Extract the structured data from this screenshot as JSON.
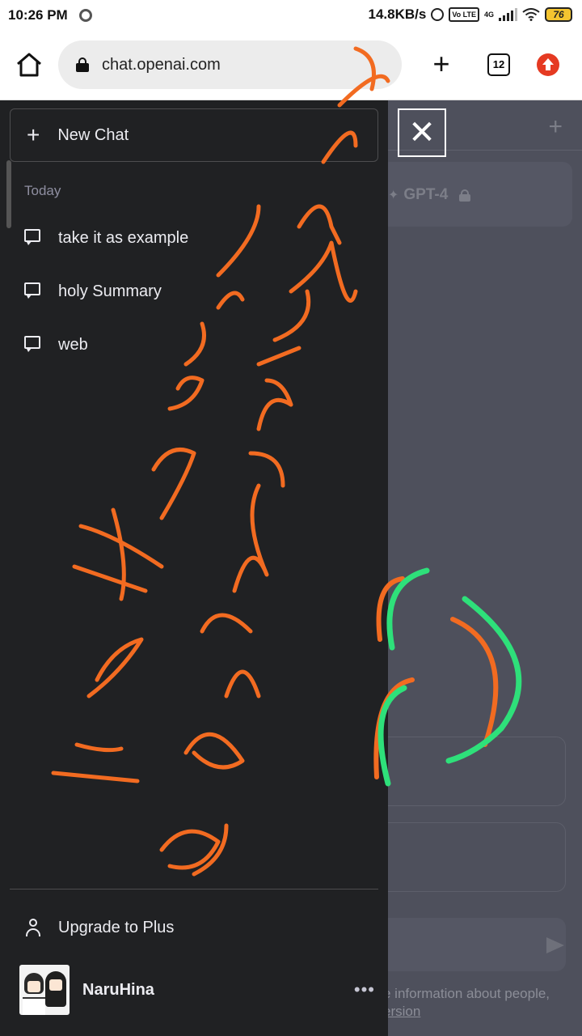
{
  "status_bar": {
    "time": "10:26 PM",
    "net_speed": "14.8KB/s",
    "network": "4G",
    "volte": "Vo LTE",
    "battery": "76"
  },
  "browser": {
    "url": "chat.openai.com",
    "tab_count": "12"
  },
  "drawer": {
    "new_chat_label": "New Chat",
    "section_label": "Today",
    "chats": [
      {
        "title": "take it as example"
      },
      {
        "title": "holy Summary"
      },
      {
        "title": "web"
      }
    ],
    "upgrade_label": "Upgrade to Plus",
    "username": "NaruHina",
    "more_label": "•••"
  },
  "main": {
    "model_label": "GPT-4",
    "disclaimer_line": "e information about people,",
    "disclaimer_link": "ersion"
  },
  "colors": {
    "drawer_bg": "#202123",
    "main_bg": "#4e505c",
    "annotation_orange": "#f26b21",
    "annotation_green": "#2ee07a"
  },
  "icons": {
    "home": "home-icon",
    "lock": "lock-icon",
    "add_tab": "plus-icon",
    "tabs": "tab-switcher-icon",
    "upgrade_browser": "arrow-up-circle-icon",
    "chat": "chat-bubble-icon",
    "user": "user-icon",
    "close": "close-icon"
  }
}
